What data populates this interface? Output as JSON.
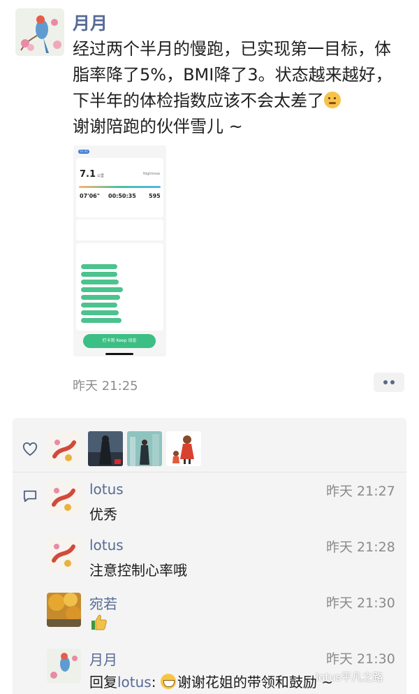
{
  "post": {
    "author": "月月",
    "text": "经过两个半月的慢跑，已实现第一目标，体脂率降了5%，BMI降了3。状态越来越好，下半年的体检指数应该不会太差了",
    "text_tail": "谢谢陪跑的伙伴雪儿 ~",
    "time": "昨天 21:25"
  },
  "screenshot": {
    "status_time": "21:31",
    "distance": "7.1",
    "distance_unit": "公里",
    "user": "Nightrose",
    "pace": "07'06\"",
    "duration": "00:50:35",
    "calories": "595",
    "button": "打卡到 Keep 动态"
  },
  "likes": {
    "icon": "heart-outline-icon",
    "avatars": [
      "avatar-koi-1",
      "avatar-night-figure",
      "avatar-city-figure",
      "avatar-girl-cartoon"
    ]
  },
  "comments": [
    {
      "name": "lotus",
      "time": "昨天 21:27",
      "text": "优秀"
    },
    {
      "name": "lotus",
      "time": "昨天 21:28",
      "text": "注意控制心率哦"
    },
    {
      "name": "宛若",
      "time": "昨天 21:30",
      "text": ""
    },
    {
      "name": "月月",
      "time": "昨天 21:30",
      "reply_prefix": "回复",
      "reply_to": "lotus",
      "text": "谢谢花姐的带领和鼓励 ~"
    }
  ],
  "watermark": "lotus平凡之路",
  "colors": {
    "link_blue": "#576b95",
    "panel_bg": "#f4f4f4",
    "keep_green": "#3cbf84"
  }
}
